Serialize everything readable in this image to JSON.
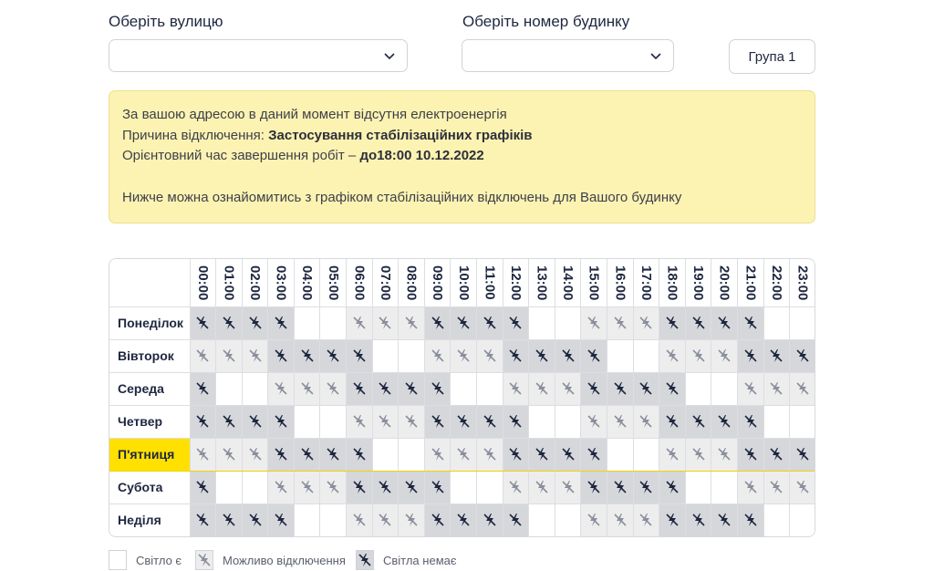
{
  "street": {
    "label": "Оберіть вулицю",
    "value": ""
  },
  "house": {
    "label": "Оберіть номер будинку",
    "value": ""
  },
  "group_button": "Група 1",
  "notice": {
    "line1": "За вашою адресою в даний момент відсутня електроенергія",
    "reason_label": "Причина відключення:",
    "reason_value": "Застосування стабілізаційних графіків",
    "eta_label": "Орієнтовний час завершення робіт –",
    "eta_value": "до18:00 10.12.2022",
    "line4": "Нижче можна ознайомитись з графіком стабілізаційних відключень для Вашого будинку"
  },
  "schedule": {
    "hours": [
      "00:00",
      "01:00",
      "02:00",
      "03:00",
      "04:00",
      "05:00",
      "06:00",
      "07:00",
      "08:00",
      "09:00",
      "10:00",
      "11:00",
      "12:00",
      "13:00",
      "14:00",
      "15:00",
      "16:00",
      "17:00",
      "18:00",
      "19:00",
      "20:00",
      "21:00",
      "22:00",
      "23:00"
    ],
    "current_day": "П'ятниця",
    "days": [
      {
        "name": "Понеділок",
        "cells": [
          2,
          2,
          2,
          2,
          0,
          0,
          1,
          1,
          1,
          2,
          2,
          2,
          2,
          0,
          0,
          1,
          1,
          1,
          2,
          2,
          2,
          2,
          0,
          0
        ]
      },
      {
        "name": "Вівторок",
        "cells": [
          1,
          1,
          1,
          2,
          2,
          2,
          2,
          0,
          0,
          1,
          1,
          1,
          2,
          2,
          2,
          2,
          0,
          0,
          1,
          1,
          1,
          2,
          2,
          2
        ]
      },
      {
        "name": "Середа",
        "cells": [
          2,
          0,
          0,
          1,
          1,
          1,
          2,
          2,
          2,
          2,
          0,
          0,
          1,
          1,
          1,
          2,
          2,
          2,
          2,
          0,
          0,
          1,
          1,
          1
        ]
      },
      {
        "name": "Четвер",
        "cells": [
          2,
          2,
          2,
          2,
          0,
          0,
          1,
          1,
          1,
          2,
          2,
          2,
          2,
          0,
          0,
          1,
          1,
          1,
          2,
          2,
          2,
          2,
          0,
          0
        ]
      },
      {
        "name": "П'ятниця",
        "cells": [
          1,
          1,
          1,
          2,
          2,
          2,
          2,
          0,
          0,
          1,
          1,
          1,
          2,
          2,
          2,
          2,
          0,
          0,
          1,
          1,
          1,
          2,
          2,
          2
        ]
      },
      {
        "name": "Субота",
        "cells": [
          2,
          0,
          0,
          1,
          1,
          1,
          2,
          2,
          2,
          2,
          0,
          0,
          1,
          1,
          1,
          2,
          2,
          2,
          2,
          0,
          0,
          1,
          1,
          1
        ]
      },
      {
        "name": "Неділя",
        "cells": [
          2,
          2,
          2,
          2,
          0,
          0,
          1,
          1,
          1,
          2,
          2,
          2,
          2,
          0,
          0,
          1,
          1,
          1,
          2,
          2,
          2,
          2,
          0,
          0
        ]
      }
    ]
  },
  "legend": {
    "power_on": "Світло є",
    "maybe_off": "Можливо відключення",
    "power_off": "Світла немає"
  },
  "icons": {
    "chevron": "chevron-down-icon",
    "maybe_off": "power-off-possible-icon",
    "power_off": "power-off-icon"
  },
  "colors": {
    "notice_bg": "#fcf3b2",
    "today_highlight": "#ffe000",
    "maybe_off_cell": "#ededee",
    "power_off_cell": "#d5d7da",
    "icon_dark": "#1e2740",
    "icon_light": "#8a8f9c"
  }
}
